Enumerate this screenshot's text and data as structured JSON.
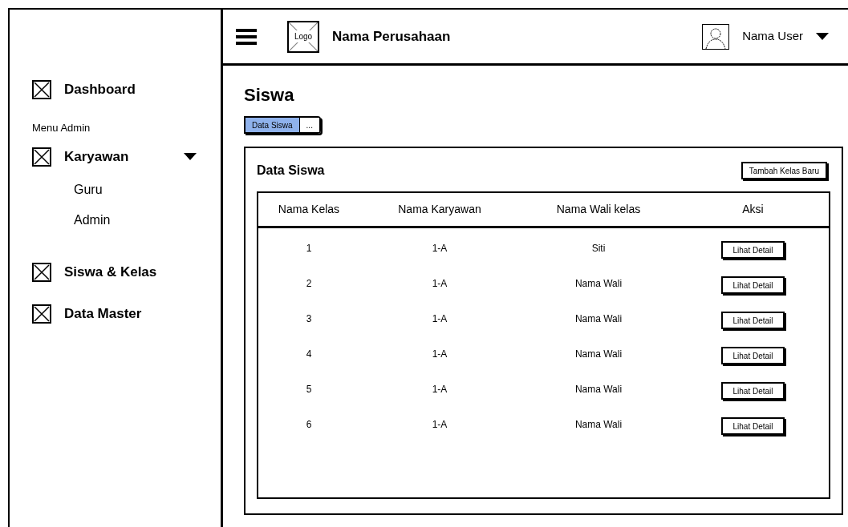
{
  "header": {
    "logo": "Logo",
    "company": "Nama Perusahaan",
    "user": "Nama User"
  },
  "sidebar": {
    "items": [
      {
        "kind": "link",
        "label": "Dashboard"
      },
      {
        "kind": "heading",
        "label": "Menu Admin"
      },
      {
        "kind": "link",
        "label": "Karyawan",
        "expanded": true,
        "children": [
          {
            "label": "Guru"
          },
          {
            "label": "Admin"
          }
        ]
      },
      {
        "kind": "link",
        "label": "Siswa & Kelas"
      },
      {
        "kind": "link",
        "label": "Data Master"
      }
    ]
  },
  "page": {
    "title": "Siswa",
    "breadcrumb": [
      {
        "label": "Data Siswa",
        "selected": true
      },
      {
        "label": "...",
        "selected": false
      }
    ]
  },
  "card": {
    "title": "Data Siswa",
    "add_button": "Tambah Kelas Baru",
    "table": {
      "columns": [
        "Nama Kelas",
        "Nama Karyawan",
        "Nama Wali kelas",
        "Aksi"
      ],
      "rows": [
        {
          "cells": [
            "1",
            "1-A",
            "Siti"
          ],
          "action": "Lihat Detail"
        },
        {
          "cells": [
            "2",
            "1-A",
            "Nama Wali"
          ],
          "action": "Lihat Detail"
        },
        {
          "cells": [
            "3",
            "1-A",
            "Nama Wali"
          ],
          "action": "Lihat Detail"
        },
        {
          "cells": [
            "4",
            "1-A",
            "Nama Wali"
          ],
          "action": "Lihat Detail"
        },
        {
          "cells": [
            "5",
            "1-A",
            "Nama Wali"
          ],
          "action": "Lihat Detail"
        },
        {
          "cells": [
            "6",
            "1-A",
            "Nama Wali"
          ],
          "action": "Lihat Detail"
        }
      ]
    }
  }
}
